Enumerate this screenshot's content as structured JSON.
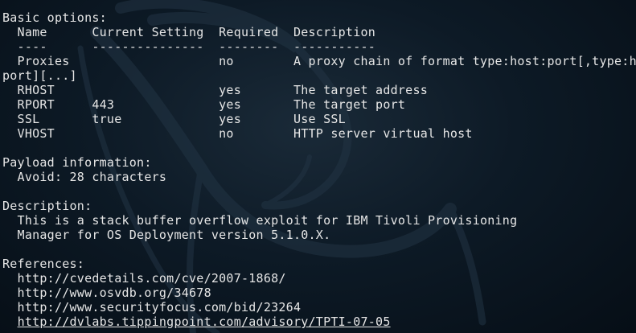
{
  "terminal": {
    "lines": [
      {
        "text": "Basic options:"
      },
      {
        "text": "  Name      Current Setting  Required  Description"
      },
      {
        "text": "  ----      ---------------  --------  -----------"
      },
      {
        "text": "  Proxies                    no        A proxy chain of format type:host:port[,type:host:"
      },
      {
        "text": "port][...]"
      },
      {
        "text": "  RHOST                      yes       The target address"
      },
      {
        "text": "  RPORT     443              yes       The target port"
      },
      {
        "text": "  SSL       true             yes       Use SSL"
      },
      {
        "text": "  VHOST                      no        HTTP server virtual host"
      },
      {
        "text": ""
      },
      {
        "text": "Payload information:"
      },
      {
        "text": "  Avoid: 28 characters"
      },
      {
        "text": ""
      },
      {
        "text": "Description:"
      },
      {
        "text": "  This is a stack buffer overflow exploit for IBM Tivoli Provisioning"
      },
      {
        "text": "  Manager for OS Deployment version 5.1.0.X."
      },
      {
        "text": ""
      },
      {
        "text": "References:"
      },
      {
        "text": "  http://cvedetails.com/cve/2007-1868/"
      },
      {
        "text": "  http://www.osvdb.org/34678"
      },
      {
        "text": "  http://www.securityfocus.com/bid/23264"
      },
      {
        "text": "  http://dvlabs.tippingpoint.com/advisory/TPTI-07-05",
        "underline": true
      }
    ]
  },
  "colors": {
    "background": "#0d1a26",
    "text": "#e6e6e6",
    "dragon": "#223444"
  },
  "background_icon": "kali-dragon-watermark"
}
